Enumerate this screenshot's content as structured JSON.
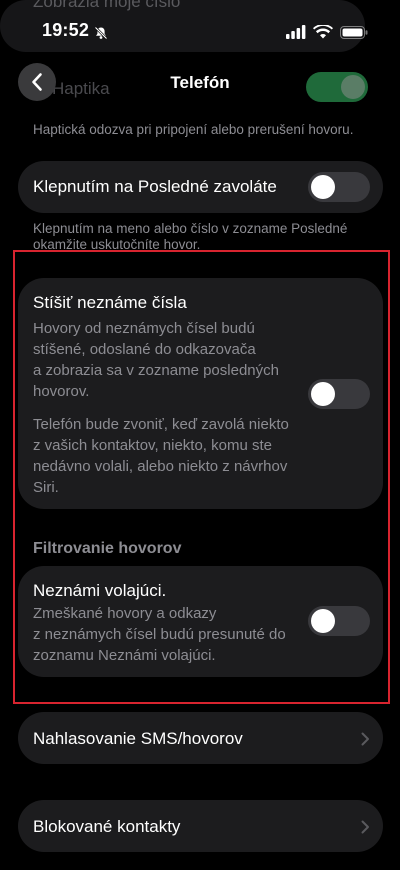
{
  "status_bar": {
    "time": "19:52",
    "icons": [
      "bell-slash-icon",
      "cellular-signal-icon",
      "wifi-icon",
      "battery-icon"
    ]
  },
  "faded_top_text": "Zobrazia moje číslo",
  "nav": {
    "title": "Telefón",
    "back_icon": "chevron-left-icon",
    "behind_label": "Haptika"
  },
  "haptics_footnote": "Haptická odozva pri pripojení alebo prerušení hovoru.",
  "recents_call": {
    "label": "Klepnutím na Posledné zavoláte",
    "toggle_on": false,
    "footnote_line1": "Klepnutím na meno alebo číslo v zozname Posledné",
    "footnote_line2": "okamžite uskutočníte hovor."
  },
  "silence_unknown": {
    "label": "Stíšiť neznáme čísla",
    "desc1_lines": [
      "Hovory od neznámych čísel budú",
      "stíšené, odoslané do odkazovača",
      "a zobrazia sa v zozname posledných",
      "hovorov."
    ],
    "desc2_lines": [
      "Telefón bude zvoniť, keď zavolá niekto",
      "z vašich kontaktov, niekto, komu ste",
      "nedávno volali, alebo niekto z návrhov",
      "Siri."
    ],
    "toggle_on": false
  },
  "call_filtering": {
    "header": "Filtrovanie hovorov",
    "unknown_callers": {
      "label": "Neznámi volajúci.",
      "desc_lines": [
        "Zmeškané hovory a odkazy",
        "z neznámych čísel budú presunuté do",
        "zoznamu Neznámi volajúci."
      ],
      "toggle_on": false
    }
  },
  "report_sms_calls": {
    "label": "Nahlasovanie SMS/hovorov"
  },
  "blocked_contacts": {
    "label": "Blokované kontakty"
  },
  "colors": {
    "highlight": "#d8242f",
    "toggle_off": "#39393d",
    "card": "#1c1c1e"
  }
}
